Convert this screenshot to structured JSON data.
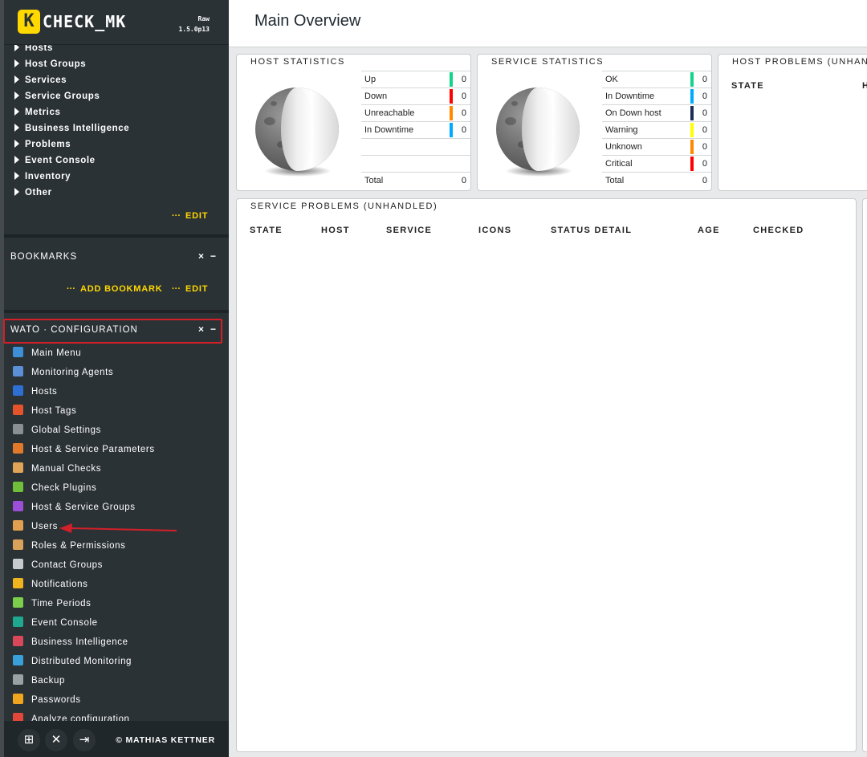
{
  "sidebar": {
    "logo_letter": "K",
    "logo_text": "CHECK_MK",
    "edition": "Raw",
    "version": "1.5.0p13",
    "views": [
      "Hosts",
      "Host Groups",
      "Services",
      "Service Groups",
      "Metrics",
      "Business Intelligence",
      "Problems",
      "Event Console",
      "Inventory",
      "Other"
    ],
    "views_edit": "EDIT",
    "bookmarks": {
      "title": "BOOKMARKS",
      "add": "ADD BOOKMARK",
      "edit": "EDIT"
    },
    "wato": {
      "title": "WATO · CONFIGURATION",
      "items": [
        {
          "label": "Main Menu",
          "color": "#3d8fd6"
        },
        {
          "label": "Monitoring Agents",
          "color": "#5b8fd6"
        },
        {
          "label": "Hosts",
          "color": "#2e6fd3"
        },
        {
          "label": "Host Tags",
          "color": "#e5532b"
        },
        {
          "label": "Global Settings",
          "color": "#8a8f93"
        },
        {
          "label": "Host & Service Parameters",
          "color": "#e07a2a"
        },
        {
          "label": "Manual Checks",
          "color": "#e0a458"
        },
        {
          "label": "Check Plugins",
          "color": "#6fbf3b"
        },
        {
          "label": "Host & Service Groups",
          "color": "#9b4fd6"
        },
        {
          "label": "Users",
          "color": "#e0a050"
        },
        {
          "label": "Roles & Permissions",
          "color": "#d9a25a"
        },
        {
          "label": "Contact Groups",
          "color": "#c8cbcd"
        },
        {
          "label": "Notifications",
          "color": "#f0b41e"
        },
        {
          "label": "Time Periods",
          "color": "#7ccf4a"
        },
        {
          "label": "Event Console",
          "color": "#1fa890"
        },
        {
          "label": "Business Intelligence",
          "color": "#d9485a"
        },
        {
          "label": "Distributed Monitoring",
          "color": "#3aa0d9"
        },
        {
          "label": "Backup",
          "color": "#9aa0a4"
        },
        {
          "label": "Passwords",
          "color": "#f0a51e"
        },
        {
          "label": "Analyze configuration",
          "color": "#e2483a"
        }
      ]
    },
    "footer": {
      "copyright": "© MATHIAS KETTNER"
    }
  },
  "main": {
    "title": "Main Overview",
    "host_stats": {
      "title": "HOST STATISTICS",
      "rows": [
        {
          "label": "Up",
          "value": "0",
          "color": "#13d389"
        },
        {
          "label": "Down",
          "value": "0",
          "color": "#ff0000"
        },
        {
          "label": "Unreachable",
          "value": "0",
          "color": "#ff8800"
        },
        {
          "label": "In Downtime",
          "value": "0",
          "color": "#00aaff"
        }
      ],
      "total_label": "Total",
      "total_value": "0"
    },
    "service_stats": {
      "title": "SERVICE STATISTICS",
      "rows": [
        {
          "label": "OK",
          "value": "0",
          "color": "#13d389"
        },
        {
          "label": "In Downtime",
          "value": "0",
          "color": "#00aaff"
        },
        {
          "label": "On Down host",
          "value": "0",
          "color": "#1e2c59"
        },
        {
          "label": "Warning",
          "value": "0",
          "color": "#ffff00"
        },
        {
          "label": "Unknown",
          "value": "0",
          "color": "#ff8800"
        },
        {
          "label": "Critical",
          "value": "0",
          "color": "#ff0000"
        }
      ],
      "total_label": "Total",
      "total_value": "0"
    },
    "host_problems": {
      "title": "HOST PROBLEMS (UNHAN",
      "col_state": "STATE",
      "col_h": "H"
    },
    "service_problems": {
      "title": "SERVICE PROBLEMS (UNHANDLED)",
      "columns": [
        "STATE",
        "HOST",
        "SERVICE",
        "ICONS",
        "STATUS DETAIL",
        "AGE",
        "CHECKED"
      ]
    }
  }
}
